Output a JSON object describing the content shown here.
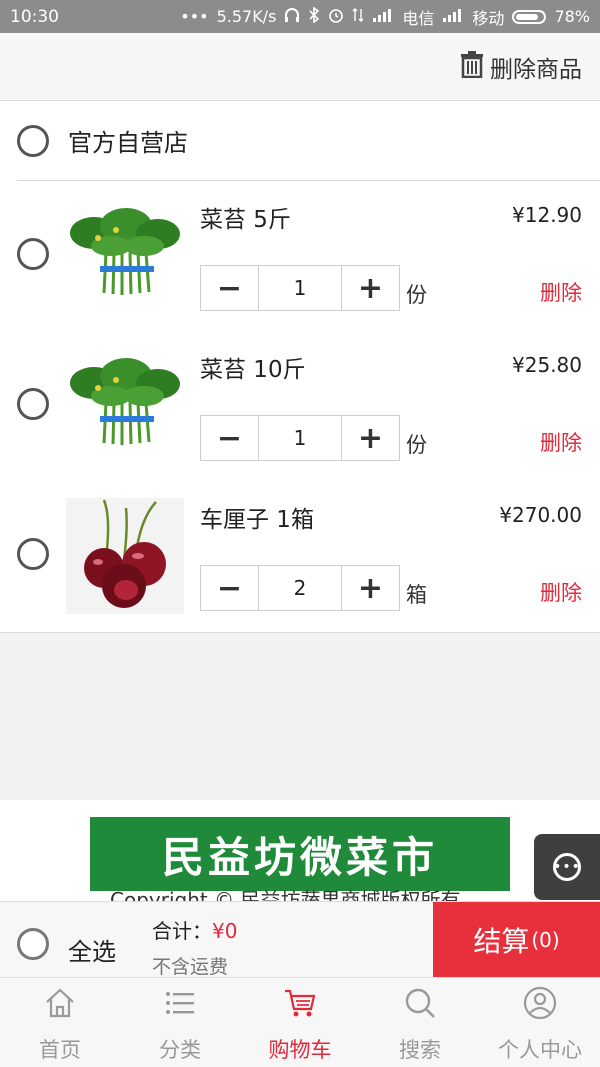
{
  "status_bar": {
    "time": "10:30",
    "dots": "•••",
    "speed": "5.57K/s",
    "carrier1": "电信",
    "carrier2": "移动",
    "battery": "78%"
  },
  "header": {
    "delete_label": "删除商品",
    "delete_icon": "trash-icon"
  },
  "store": {
    "name": "官方自营店"
  },
  "items": [
    {
      "title": "菜苔  5斤",
      "price": "¥12.90",
      "qty": "1",
      "unit": "份",
      "remove": "删除",
      "image": "vegetable-photo"
    },
    {
      "title": "菜苔  10斤",
      "price": "¥25.80",
      "qty": "1",
      "unit": "份",
      "remove": "删除",
      "image": "vegetable-photo"
    },
    {
      "title": "车厘子  1箱",
      "price": "¥270.00",
      "qty": "2",
      "unit": "箱",
      "remove": "删除",
      "image": "cherry-photo"
    }
  ],
  "stepper": {
    "minus": "−",
    "plus": "+"
  },
  "banner": {
    "text": "民益坊微菜市"
  },
  "copyright": "Copyright © 民益坊蔬果商城版权所有",
  "checkout": {
    "select_all": "全选",
    "total_label": "合计：",
    "total_value": "¥0",
    "shipping_note": "不含运费",
    "settle_label": "结算",
    "settle_count": "(0)"
  },
  "nav": [
    {
      "label": "首页",
      "icon": "home-icon"
    },
    {
      "label": "分类",
      "icon": "list-icon"
    },
    {
      "label": "购物车",
      "icon": "cart-icon",
      "active": true
    },
    {
      "label": "搜索",
      "icon": "search-icon"
    },
    {
      "label": "个人中心",
      "icon": "user-icon"
    }
  ],
  "colors": {
    "accent": "#e02b3b",
    "banner": "#1f8a3a"
  }
}
